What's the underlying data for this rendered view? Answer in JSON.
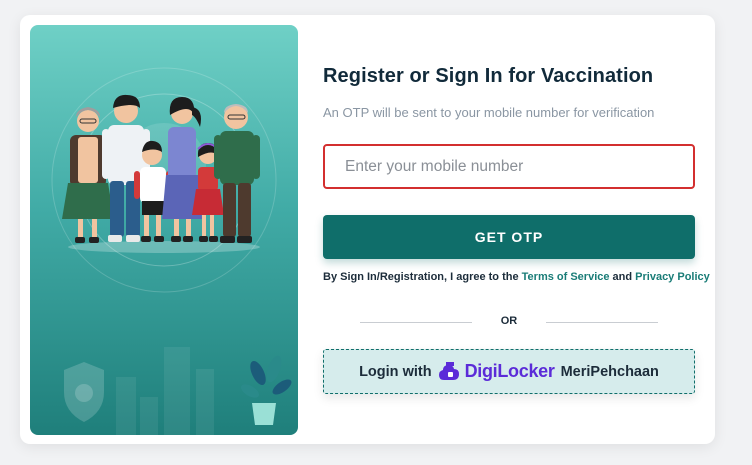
{
  "form": {
    "title": "Register or Sign In for Vaccination",
    "subtitle": "An OTP will be sent to your mobile number for verification",
    "mobile_placeholder": "Enter your mobile number",
    "get_otp_label": "GET OTP",
    "terms_prefix": "By Sign In/Registration, I agree to the ",
    "terms_link": "Terms of Service",
    "terms_and": " and ",
    "privacy_link": "Privacy Policy",
    "or_label": "OR",
    "login_with_label": "Login with",
    "digilocker_brand": "DigiLocker",
    "meripehchaan_label": "MeriPehchaan"
  },
  "colors": {
    "primary": "#0f6e6a",
    "input_border_error": "#d32f2f",
    "digilocker_purple": "#5b2bd8",
    "illustration_top": "#6fd0c6",
    "illustration_bottom": "#1f7f7b"
  },
  "icons": [
    "family-illustration",
    "shield-icon",
    "plant-icon",
    "digilocker-cloud-icon"
  ]
}
